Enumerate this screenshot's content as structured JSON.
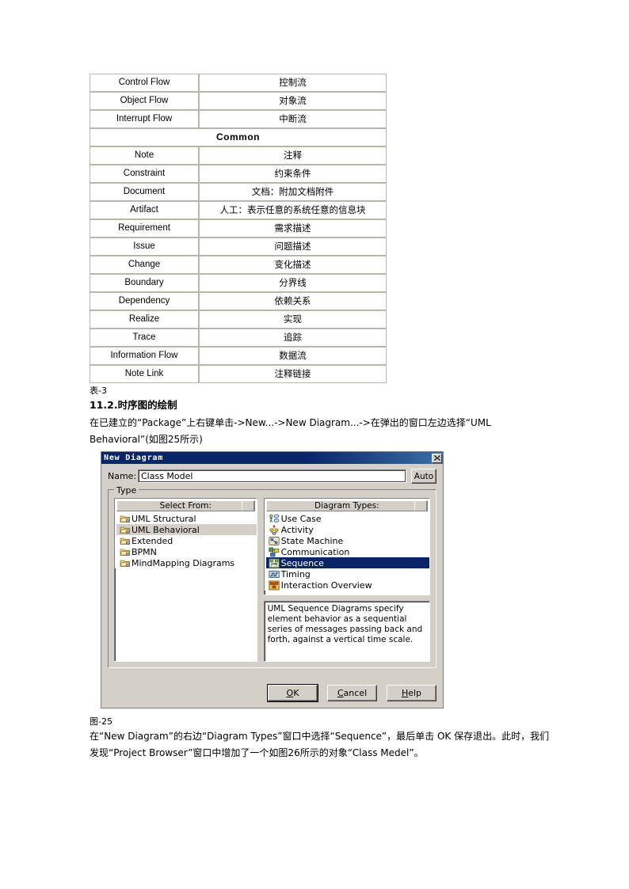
{
  "table": {
    "caption": "表-3",
    "rows": [
      {
        "type": "pair",
        "en": "Control Flow",
        "zh": "控制流"
      },
      {
        "type": "pair",
        "en": "Object Flow",
        "zh": "对象流"
      },
      {
        "type": "pair",
        "en": "Interrupt Flow",
        "zh": "中断流"
      },
      {
        "type": "section",
        "label": "Common"
      },
      {
        "type": "pair",
        "en": "Note",
        "zh": "注释"
      },
      {
        "type": "pair",
        "en": "Constraint",
        "zh": "约束条件"
      },
      {
        "type": "pair",
        "en": "Document",
        "zh": "文档：附加文档附件"
      },
      {
        "type": "pair",
        "en": "Artifact",
        "zh": "人工：表示任意的系统任意的信息块"
      },
      {
        "type": "pair",
        "en": "Requirement",
        "zh": "需求描述"
      },
      {
        "type": "pair",
        "en": "Issue",
        "zh": "问题描述"
      },
      {
        "type": "pair",
        "en": "Change",
        "zh": "变化描述"
      },
      {
        "type": "pair",
        "en": "Boundary",
        "zh": "分界线"
      },
      {
        "type": "pair",
        "en": "Dependency",
        "zh": "依赖关系"
      },
      {
        "type": "pair",
        "en": "Realize",
        "zh": "实现"
      },
      {
        "type": "pair",
        "en": "Trace",
        "zh": "追踪"
      },
      {
        "type": "pair",
        "en": "Information Flow",
        "zh": "数据流"
      },
      {
        "type": "pair",
        "en": "Note Link",
        "zh": "注释链接"
      }
    ]
  },
  "section": {
    "heading": "11.2.时序图的绘制",
    "intro": "在已建立的“Package”上右键单击->New...->New Diagram...->在弹出的窗口左边选择“UML Behavioral”(如图25所示)",
    "figure_caption": "图-25",
    "closing": "在“New Diagram”的右边“Diagram Types”窗口中选择“Sequence”，最后单击 OK 保存退出。此时，我们发现“Project Browser”窗口中增加了一个如图26所示的对象“Class Medel”。"
  },
  "dialog": {
    "title": "New Diagram",
    "close_icon": "close-icon",
    "name_label": "Name:",
    "name_value": "Class Model",
    "name_placeholder": "",
    "auto_label": "Auto",
    "type_group_label": "Type",
    "select_from": {
      "header": "Select From:",
      "items": [
        {
          "label": "UML Structural",
          "icon": "folder-icon",
          "selected": false
        },
        {
          "label": "UML Behavioral",
          "icon": "folder-icon",
          "selected": true
        },
        {
          "label": "Extended",
          "icon": "folder-icon",
          "selected": false
        },
        {
          "label": "BPMN",
          "icon": "folder-icon",
          "selected": false
        },
        {
          "label": "MindMapping Diagrams",
          "icon": "folder-icon",
          "selected": false
        }
      ]
    },
    "diagram_types": {
      "header": "Diagram Types:",
      "items": [
        {
          "label": "Use Case",
          "icon": "use-case-icon",
          "selected": false
        },
        {
          "label": "Activity",
          "icon": "activity-icon",
          "selected": false
        },
        {
          "label": "State Machine",
          "icon": "state-machine-icon",
          "selected": false
        },
        {
          "label": "Communication",
          "icon": "communication-icon",
          "selected": false
        },
        {
          "label": "Sequence",
          "icon": "sequence-icon",
          "selected": true
        },
        {
          "label": "Timing",
          "icon": "timing-icon",
          "selected": false
        },
        {
          "label": "Interaction Overview",
          "icon": "interaction-overview-icon",
          "selected": false
        }
      ]
    },
    "description": "UML Sequence Diagrams specify element behavior as a sequential series of messages passing back and forth, against a vertical time scale.",
    "buttons": [
      {
        "label": "OK",
        "mnemonic": "O",
        "default": true
      },
      {
        "label": "Cancel",
        "mnemonic": "C",
        "default": false
      },
      {
        "label": "Help",
        "mnemonic": "H",
        "default": false
      }
    ]
  },
  "colors": {
    "titlebar": "#0a246a",
    "dialog_face": "#d4d0c8",
    "selection": "#0a246a",
    "soft_selection": "#d4d0c8",
    "table_border": "#b8b8a8"
  }
}
